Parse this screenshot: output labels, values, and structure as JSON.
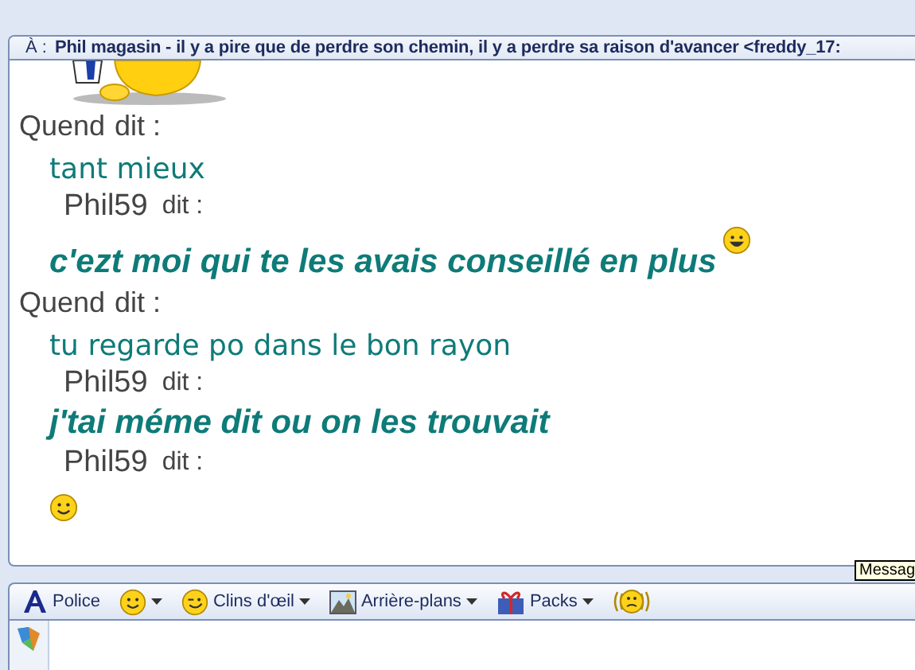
{
  "conversation": {
    "prefix": "À :",
    "title": "Phil magasin - il y a pire que de perdre son chemin, il y a perdre sa raison d'avancer <freddy_17:"
  },
  "messages": [
    {
      "kind": "sender",
      "name": "Quend",
      "said": "dit :",
      "indent": false
    },
    {
      "kind": "handwritten",
      "text": "tant mieux",
      "trailing_emoticon": false
    },
    {
      "kind": "sender",
      "name": "Phil59",
      "said": "dit :",
      "indent": true
    },
    {
      "kind": "emphasized",
      "text": "c'ezt moi qui te les avais conseillé en plus",
      "trailing_emoticon": true
    },
    {
      "kind": "sender",
      "name": "Quend",
      "said": "dit :",
      "indent": false
    },
    {
      "kind": "handwritten",
      "text": "tu regarde po dans le bon rayon",
      "trailing_emoticon": false
    },
    {
      "kind": "sender",
      "name": "Phil59",
      "said": "dit :",
      "indent": true
    },
    {
      "kind": "emphasized",
      "text": "j'tai méme dit ou on les trouvait",
      "trailing_emoticon": false
    },
    {
      "kind": "sender",
      "name": "Phil59",
      "said": "dit :",
      "indent": true
    },
    {
      "kind": "emoticon"
    }
  ],
  "tooltip": "Messag",
  "toolbar": [
    {
      "kind": "font",
      "label": "Police",
      "caret": false
    },
    {
      "kind": "smiley",
      "caret": true
    },
    {
      "kind": "wink",
      "label": "Clins d'œil",
      "caret": true
    },
    {
      "kind": "background",
      "label": "Arrière-plans",
      "caret": true
    },
    {
      "kind": "gift",
      "label": "Packs",
      "caret": true
    },
    {
      "kind": "nudge",
      "caret": false
    }
  ]
}
